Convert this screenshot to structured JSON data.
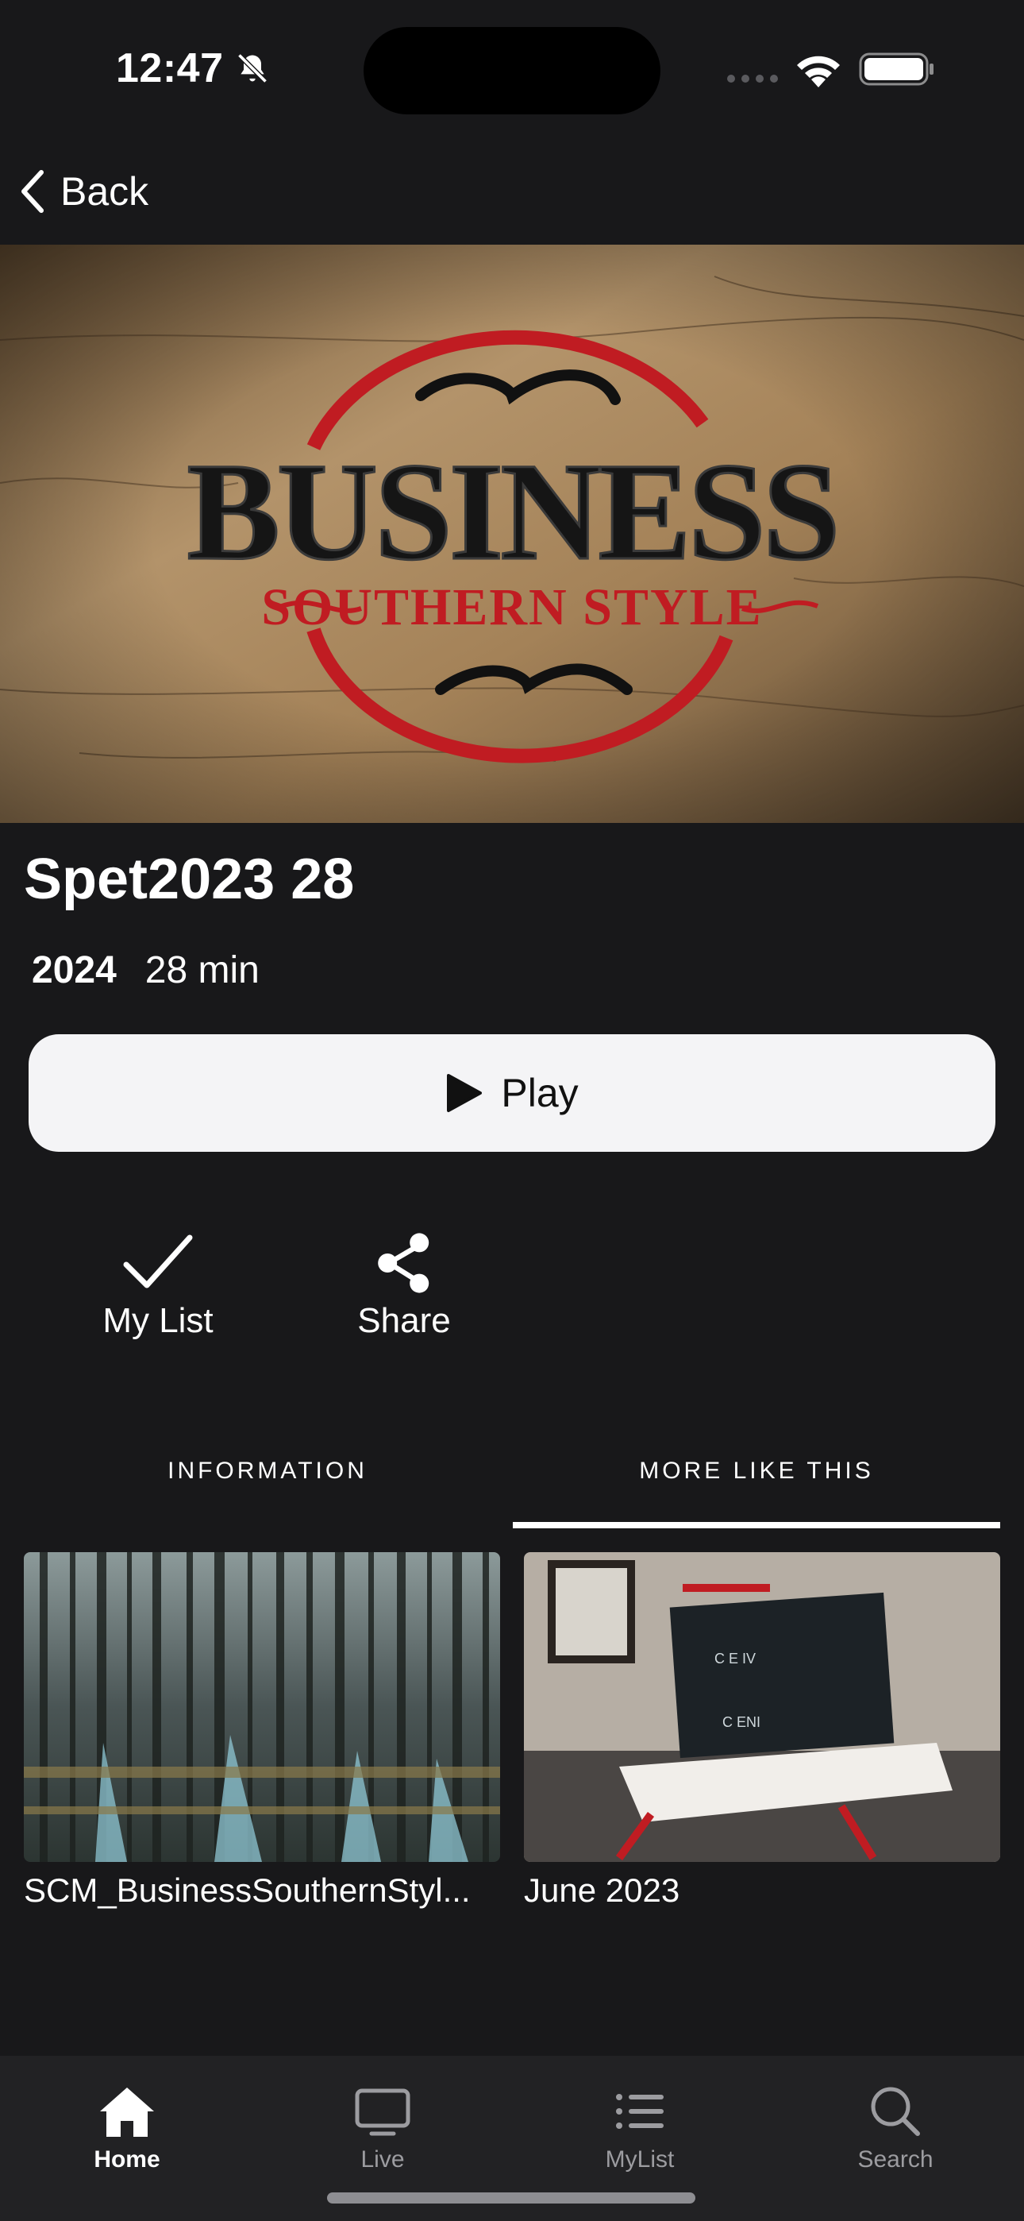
{
  "status_bar": {
    "time": "12:47",
    "icons": [
      "bell-slash-icon",
      "signal-icon",
      "wifi-icon",
      "battery-icon"
    ]
  },
  "nav": {
    "back_label": "Back",
    "back_icon": "chevron-left-icon"
  },
  "hero": {
    "image": "business-southern-style-logo"
  },
  "episode": {
    "title": "Spet2023 28",
    "year": "2024",
    "duration": "28 min"
  },
  "play_button": {
    "label": "Play",
    "icon": "play-icon"
  },
  "actions": [
    {
      "label": "My List",
      "icon": "checkmark-icon"
    },
    {
      "label": "Share",
      "icon": "share-icon"
    }
  ],
  "tabs": [
    {
      "label": "INFORMATION",
      "active": false
    },
    {
      "label": "MORE LIKE THIS",
      "active": true
    }
  ],
  "more_like_this": [
    {
      "title": "SCM_BusinessSouthernStyl...",
      "thumb": "swamp-forest"
    },
    {
      "title": "June 2023",
      "thumb": "tv-stand-room"
    }
  ],
  "tab_bar": [
    {
      "label": "Home",
      "icon": "home-icon",
      "active": true
    },
    {
      "label": "Live",
      "icon": "tv-icon",
      "active": false
    },
    {
      "label": "MyList",
      "icon": "list-icon",
      "active": false
    },
    {
      "label": "Search",
      "icon": "search-icon",
      "active": false
    }
  ],
  "colors": {
    "background": "#18181a",
    "tab_bar": "#222224",
    "play_button_bg": "#f4f4f6",
    "logo_red": "#c01c22"
  }
}
